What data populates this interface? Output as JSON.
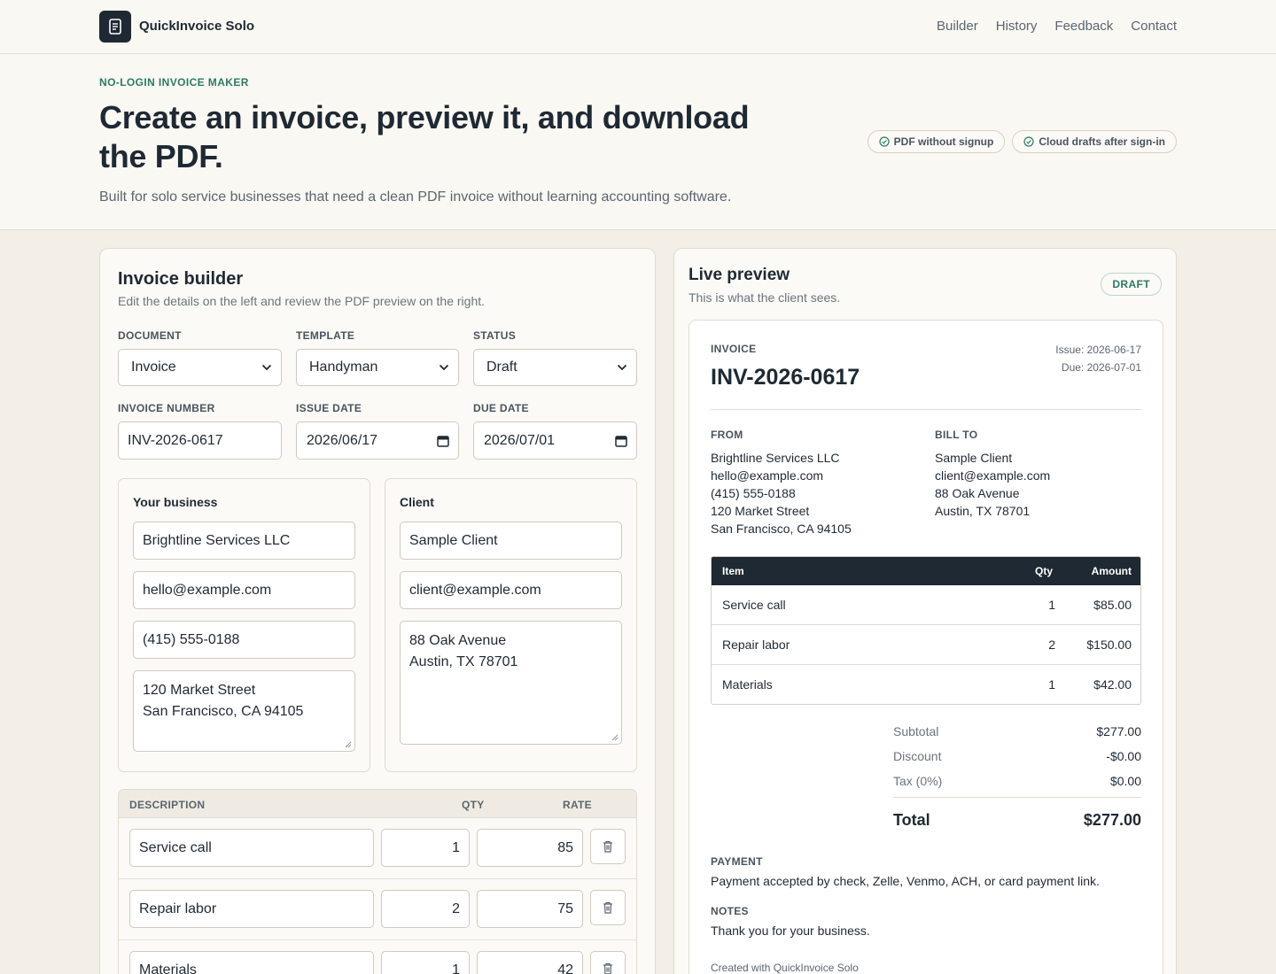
{
  "header": {
    "brand": "QuickInvoice Solo",
    "nav": [
      "Builder",
      "History",
      "Feedback",
      "Contact"
    ]
  },
  "hero": {
    "eyebrow": "NO-LOGIN INVOICE MAKER",
    "title": "Create an invoice, preview it, and download the PDF.",
    "subtitle": "Built for solo service businesses that need a clean PDF invoice without learning accounting software.",
    "pills": [
      "PDF without signup",
      "Cloud drafts after sign-in"
    ]
  },
  "builder": {
    "title": "Invoice builder",
    "subtitle": "Edit the details on the left and review the PDF preview on the right.",
    "labels": {
      "document": "DOCUMENT",
      "template": "TEMPLATE",
      "status": "STATUS",
      "invoice_number": "INVOICE NUMBER",
      "issue_date": "ISSUE DATE",
      "due_date": "DUE DATE"
    },
    "values": {
      "document": "Invoice",
      "template": "Handyman",
      "status": "Draft",
      "invoice_number": "INV-2026-0617",
      "issue_date": "2026/06/17",
      "due_date": "2026/07/01"
    },
    "business": {
      "heading": "Your business",
      "name": "Brightline Services LLC",
      "email": "hello@example.com",
      "phone": "(415) 555-0188",
      "address": "120 Market Street\nSan Francisco, CA 94105"
    },
    "client": {
      "heading": "Client",
      "name": "Sample Client",
      "email": "client@example.com",
      "address": "88 Oak Avenue\nAustin, TX 78701"
    },
    "items_header": {
      "description": "DESCRIPTION",
      "qty": "QTY",
      "rate": "RATE"
    },
    "items": [
      {
        "description": "Service call",
        "qty": "1",
        "rate": "85"
      },
      {
        "description": "Repair labor",
        "qty": "2",
        "rate": "75"
      },
      {
        "description": "Materials",
        "qty": "1",
        "rate": "42"
      }
    ]
  },
  "preview": {
    "title": "Live preview",
    "subtitle": "This is what the client sees.",
    "badge": "DRAFT",
    "doc_label": "INVOICE",
    "invoice_number": "INV-2026-0617",
    "issue": "Issue: 2026-06-17",
    "due": "Due: 2026-07-01",
    "from_label": "FROM",
    "from_lines": [
      "Brightline Services LLC",
      "hello@example.com",
      "(415) 555-0188",
      "120 Market Street",
      "San Francisco, CA 94105"
    ],
    "bill_label": "BILL TO",
    "bill_lines": [
      "Sample Client",
      "client@example.com",
      "88 Oak Avenue",
      "Austin, TX 78701"
    ],
    "table_header": {
      "item": "Item",
      "qty": "Qty",
      "amount": "Amount"
    },
    "rows": [
      {
        "item": "Service call",
        "qty": "1",
        "amount": "$85.00"
      },
      {
        "item": "Repair labor",
        "qty": "2",
        "amount": "$150.00"
      },
      {
        "item": "Materials",
        "qty": "1",
        "amount": "$42.00"
      }
    ],
    "subtotal_label": "Subtotal",
    "subtotal": "$277.00",
    "discount_label": "Discount",
    "discount": "-$0.00",
    "tax_label": "Tax (0%)",
    "tax": "$0.00",
    "total_label": "Total",
    "total": "$277.00",
    "payment_label": "PAYMENT",
    "payment": "Payment accepted by check, Zelle, Venmo, ACH, or card payment link.",
    "notes_label": "NOTES",
    "notes": "Thank you for your business.",
    "footer": "Created with QuickInvoice Solo"
  }
}
